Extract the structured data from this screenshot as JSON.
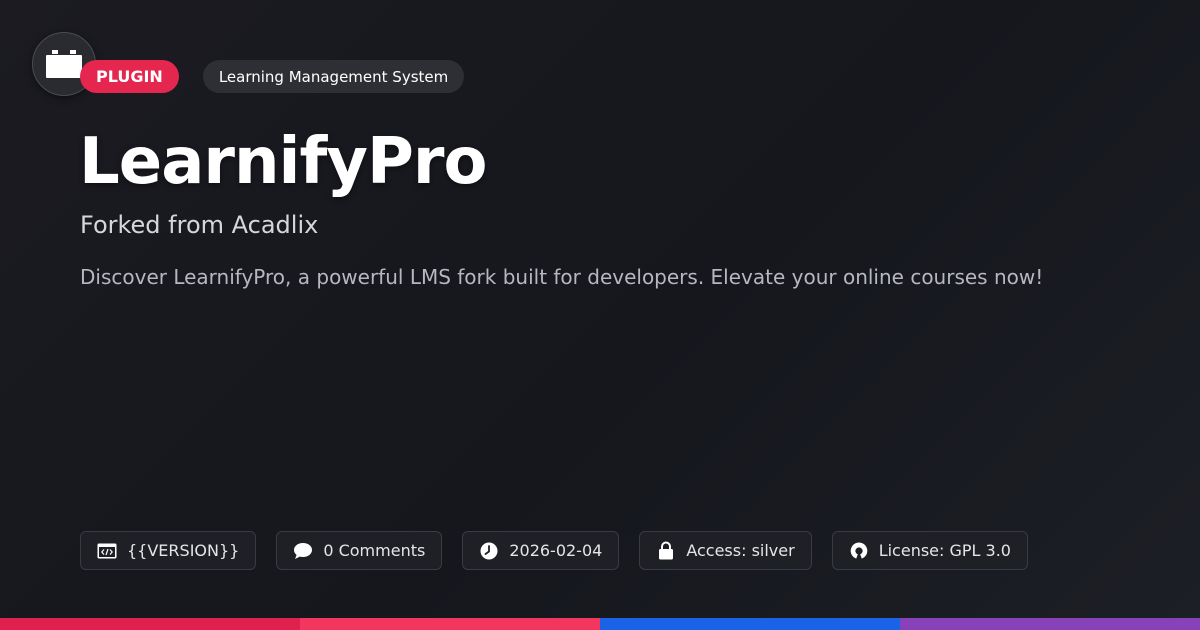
{
  "logo": {
    "icon": "plugin-block-icon"
  },
  "tags": {
    "type_label": "PLUGIN",
    "category_label": "Learning Management System"
  },
  "title": "LearnifyPro",
  "subtitle": "Forked from Acadlix",
  "description": "Discover LearnifyPro, a powerful LMS fork built for developers. Elevate your online courses now!",
  "meta": {
    "version": {
      "icon": "code-window-icon",
      "label": "{{VERSION}}"
    },
    "comments": {
      "icon": "speech-bubble-icon",
      "label": "0 Comments"
    },
    "date": {
      "icon": "clock-icon",
      "label": "2026-02-04"
    },
    "access": {
      "icon": "lock-icon",
      "label": "Access: silver"
    },
    "license": {
      "icon": "open-source-icon",
      "label": "License: GPL 3.0"
    }
  },
  "colors": {
    "accent": "#e5264f",
    "bar": [
      "#e02150",
      "#f2365e",
      "#1a63e6",
      "#8842b8"
    ]
  }
}
